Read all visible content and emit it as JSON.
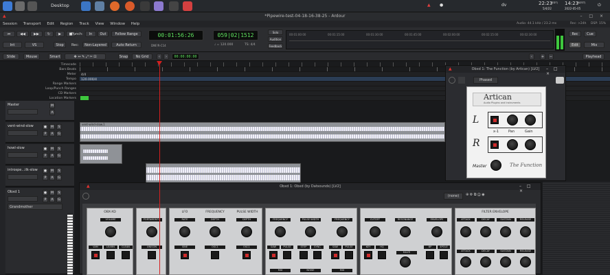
{
  "taskbar": {
    "desktop_label": "Desktop",
    "kb_layout": "dv",
    "clock1_time": "22:23",
    "clock1_tz": "(EDT)",
    "clock1_date": "5/4/22",
    "clock2_time": "14:23",
    "clock2_tz": "(NZST)",
    "clock2_date": "2022-05-05"
  },
  "window": {
    "title": "*Pipewire-test-04-18-16-38-25 - Ardour",
    "audio_info": "Audio: 44.1 kHz / 23.2 ms",
    "rec_info": "Rec: >24h",
    "dsp_info": "DSP: 15%"
  },
  "menu": [
    "Session",
    "Transport",
    "Edit",
    "Region",
    "Track",
    "View",
    "Window",
    "Help"
  ],
  "toolbar": {
    "punch": "Punch:",
    "in": "In",
    "out": "Out",
    "follow": "Follow Range",
    "rec": "Rec:",
    "nonlayered": "Non-Layered",
    "auto_return": "Auto Return",
    "int": "Int",
    "vs": "VS",
    "stop": "Stop",
    "time": "00:01:56:26",
    "bbt": "059|02|1512",
    "tempo": "♩ = 120.000",
    "meter": "TS: 4/4",
    "solo": "Solo",
    "audition": "Audition",
    "feedback": "Feedback",
    "rec_btn": "Rec",
    "cue": "Cue",
    "edit": "Edit",
    "mix": "Mix",
    "r1": "00:01:00:00",
    "r2": "00:01:15:00",
    "r3": "00:01:30:00",
    "r4": "00:01:45:00",
    "r5": "00:02:00:00",
    "r6": "00:02:15:00",
    "r7": "00:02:30:00"
  },
  "editbar": {
    "slide": "Slide",
    "mouse": "Mouse",
    "smart": "Smart",
    "snap": "Snap",
    "no_grid": "No Grid",
    "nudge": "00:00:00:00",
    "playhead": "Playhead"
  },
  "rulers": [
    "Timecode",
    "Bars:Beats",
    "Meter",
    "Tempo",
    "Range Markers",
    "Loop/Punch Ranges",
    "CD Markers",
    "Location Markers"
  ],
  "ruler_values": {
    "meter": "4/4",
    "tempo": "120.000/4"
  },
  "tracks": [
    {
      "name": "Master"
    },
    {
      "name": "vent-wind-slow",
      "region": "vent-wind-slow.1"
    },
    {
      "name": "howl-slow"
    },
    {
      "name": "introspe...ilk-slow"
    },
    {
      "name": "Obxd 1"
    }
  ],
  "track_buttons": {
    "m": "M",
    "s": "S",
    "p": "P",
    "a": "A",
    "g": "G"
  },
  "grandmother": "Grandmother",
  "plugin1": {
    "title": "Obxd 1: The Function (by Artican) [LV2]",
    "preset": "Phased",
    "brand": "Artican",
    "brand_sub": "Audio Plugins and Instruments",
    "l": "L",
    "r": "R",
    "x1": "x-1",
    "pan": "Pan",
    "gain": "Gain",
    "master": "Master",
    "logo": "The Function"
  },
  "plugin2": {
    "title": "Obxd 1: Obxd (by Datsounds) [LV2]",
    "preset": "(none)",
    "sections": [
      {
        "title": "OBX-XD",
        "knobs": [
          "VOLUME"
        ],
        "switches": [
          "VAM",
          "LEARN",
          "CLEAN"
        ]
      },
      {
        "title": "",
        "knobs": [
          "PORTAMENTO"
        ],
        "switches": [
          "UNISON"
        ]
      },
      {
        "title": "LFO",
        "knobs": [
          "RATE"
        ],
        "switches": [
          "SINE"
        ]
      },
      {
        "title": "FREQUENCY",
        "knobs": [
          "DEPTH"
        ],
        "switches": [
          "OSC1"
        ]
      },
      {
        "title": "PULSE WIDTH",
        "knobs": [
          "DEPTH"
        ],
        "switches": [
          "OSC1"
        ]
      },
      {
        "title": "",
        "knobs": [
          "FREQUENCY",
          "PULSE WIDTH",
          "FREQUENCY"
        ],
        "switches": [
          "SAW",
          "PULSE",
          "STEP",
          "SYNC",
          "SAW",
          "PULSE"
        ],
        "labels": [
          "MIX",
          "NOISE",
          "MIX"
        ]
      },
      {
        "title": "",
        "knobs": [
          "CUTOFF",
          "RESONANCE",
          "ENVELOPE"
        ],
        "switches": [
          "KEY",
          "HQ",
          "MULTI",
          "BP",
          "4POLE"
        ]
      },
      {
        "title": "FILTER ENVELOPE",
        "knobs": [
          "ATTACK",
          "DECAY",
          "SUSTAIN",
          "RELEASE",
          "ATTACK",
          "DECAY",
          "SUSTAIN",
          "RELEASE"
        ]
      }
    ]
  },
  "colors": {
    "accent_red": "#e0322f",
    "clock_green": "#5fe35f",
    "playhead": "#d61f1f"
  }
}
